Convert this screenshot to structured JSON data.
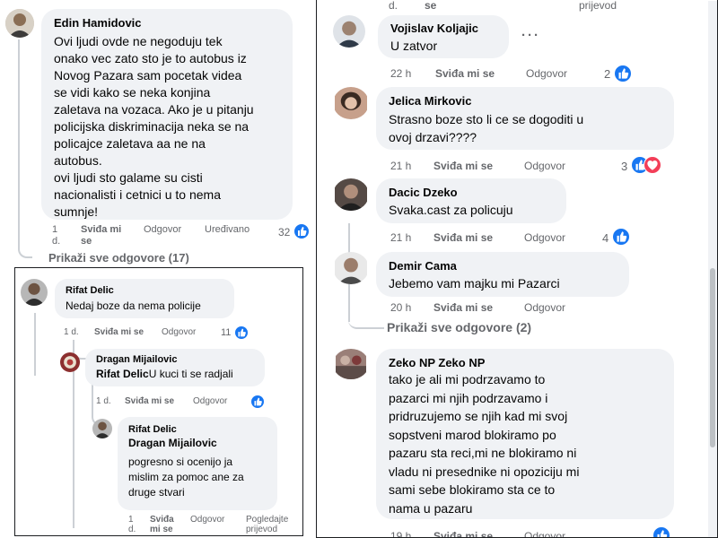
{
  "colors": {
    "accent": "#1877f2",
    "meta": "#65676b",
    "bubble": "#f0f2f5",
    "heart": "#f33e58"
  },
  "panel_a": {
    "comment": {
      "author": "Edin Hamidovic",
      "text": "Ovi ljudi ovde ne negoduju tek\nonako vec zato sto je to autobus iz\nNovog Pazara sam pocetak videa\nse vidi kako se neka konjina\nzaletava na vozaca. Ako je u pitanju\npolicijska diskriminacija neka se na\npolicajce zaletava aa ne na\nautobus.\novi ljudi sto galame su cisti\nnacionalisti i cetnici u to nema\nsumnje!",
      "time": "1\nd.",
      "like": "Sviđa mi\nse",
      "reply": "Odgovor",
      "edited": "Uređivano",
      "reactions": "32"
    },
    "show_replies": "Prikaži sve odgovore (17)"
  },
  "panel_b": {
    "comment1": {
      "author": "Rifat Delic",
      "text": "Nedaj boze da nema policije",
      "time": "1 d.",
      "like": "Sviđa mi se",
      "reply": "Odgovor",
      "reactions": "11"
    },
    "reply1": {
      "author": "Dragan Mijailovic",
      "mention": "Rifat Delic",
      "text": "U kuci ti se radjali",
      "time": "1 d.",
      "like": "Sviđa mi se",
      "reply": "Odgovor"
    },
    "reply2": {
      "author": "Rifat Delic",
      "mention": "Dragan Mijailovic",
      "text": "pogresno si ocenijo ja\nmislim za pomoc ane za\ndruge stvari",
      "time": "1\nd.",
      "like": "Sviđa\nmi se",
      "reply": "Odgovor",
      "translate": "Pogledajte\nprijevod"
    }
  },
  "panel_c": {
    "top_fragment": {
      "time": "d.",
      "like": "se",
      "translate": "prijevod"
    },
    "comments": [
      {
        "author": "Vojislav Koljajic",
        "text": "U zatvor",
        "time": "22 h",
        "like": "Sviđa mi se",
        "reply": "Odgovor",
        "reactions": "2"
      },
      {
        "author": "Jelica Mirkovic",
        "text": "Strasno boze sto li ce se dogoditi u\novoj drzavi????",
        "time": "21 h",
        "like": "Sviđa mi se",
        "reply": "Odgovor",
        "reactions": "3"
      },
      {
        "author": "Dacic Dzeko",
        "text": "Svaka.cast za policuju",
        "time": "21 h",
        "like": "Sviđa mi se",
        "reply": "Odgovor",
        "reactions": "4"
      },
      {
        "author": "Demir Cama",
        "text": "Jebemo vam majku mi Pazarci",
        "time": "20 h",
        "like": "Sviđa mi se",
        "reply": "Odgovor"
      },
      {
        "author": "Zeko NP Zeko NP",
        "text": "tako je ali mi podrzavamo to\npazarci mi njih podrzavamo i\npridruzujemo se njih kad mi svoj\nsopstveni marod blokiramo po\npazaru sta reci,mi ne blokiramo ni\nvladu ni presednike ni opoziciju mi\nsami sebe blokiramo sta ce to\nnama u pazaru",
        "time": "19 h",
        "like": "Sviđa mi se",
        "reply": "Odgovor"
      }
    ],
    "show_replies": "Prikaži sve odgovore (2)",
    "more_options": "···"
  }
}
